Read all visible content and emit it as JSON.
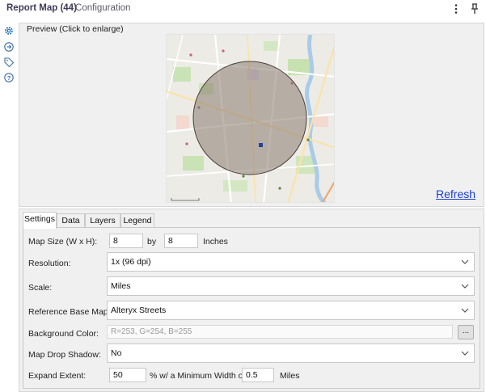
{
  "window": {
    "title": "Report Map (44)",
    "subtitle": "- Configuration"
  },
  "preview": {
    "legend": "Preview (Click to enlarge)",
    "refresh_label": "Refresh"
  },
  "tabs": [
    "Settings",
    "Data",
    "Layers",
    "Legend"
  ],
  "settings": {
    "map_size": {
      "label": "Map Size (W x H):",
      "width": "8",
      "by": "by",
      "height": "8",
      "unit": "Inches"
    },
    "resolution": {
      "label": "Resolution:",
      "value": "1x (96 dpi)"
    },
    "scale": {
      "label": "Scale:",
      "value": "Miles"
    },
    "reference_base_map": {
      "label": "Reference Base Map:",
      "value": "Alteryx Streets"
    },
    "background_color": {
      "label": "Background Color:",
      "value": "R=253, G=254, B=255",
      "button": "..."
    },
    "map_drop_shadow": {
      "label": "Map Drop Shadow:",
      "value": "No"
    },
    "expand_extent": {
      "label": "Expand Extent:",
      "value": "50",
      "mid_text": "% w/ a Minimum Width of",
      "min_width": "0.5",
      "unit": "Miles"
    }
  },
  "colors": {
    "circle_fill": "#8a7a6e",
    "link": "#1a3fd0",
    "panel_bg": "#f0f0f0"
  },
  "icons": {
    "toolbar": [
      "more-vertical-icon",
      "pin-icon"
    ],
    "sidebar": [
      "gear-icon",
      "connection-icon",
      "tag-icon",
      "help-icon"
    ]
  }
}
